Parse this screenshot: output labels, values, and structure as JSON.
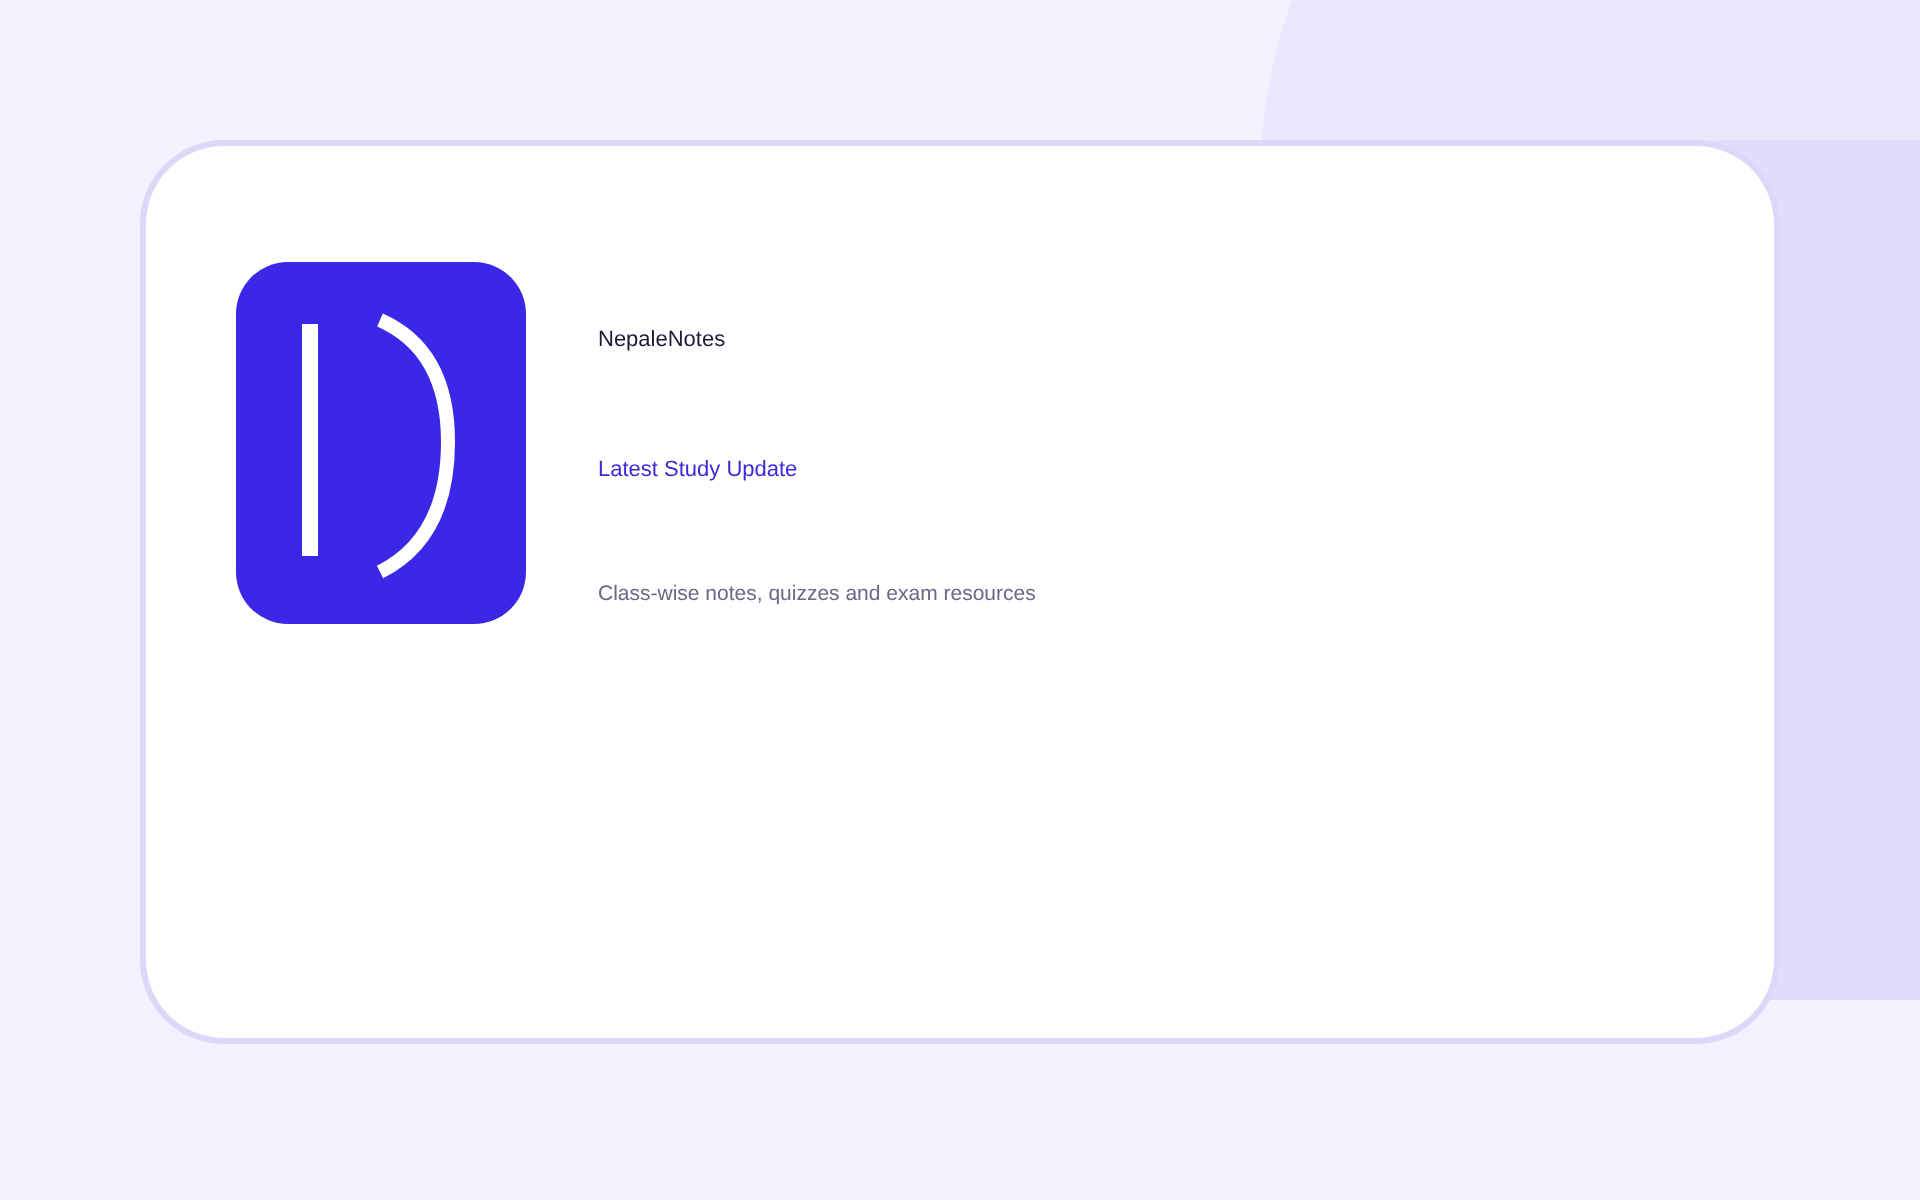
{
  "brand": {
    "name": "NepaleNotes"
  },
  "update": {
    "heading": "Latest Study Update",
    "description": "Class-wise notes, quizzes and exam resources"
  }
}
